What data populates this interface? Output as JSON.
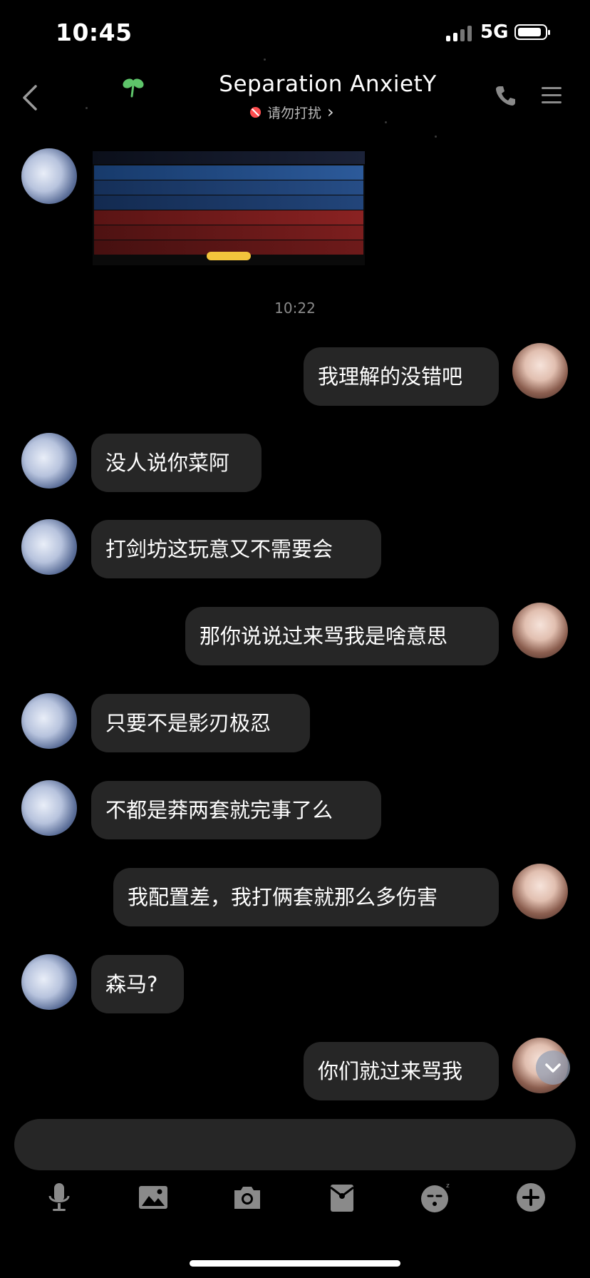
{
  "status_bar": {
    "time": "10:45",
    "network": "5G",
    "battery_level": 0.85
  },
  "header": {
    "title": "Separation AnxietY",
    "subtitle": "请勿打扰",
    "subtitle_chevron": "›"
  },
  "messages": [
    {
      "side": "left",
      "type": "image",
      "description_icon": "game-scoreboard-image"
    },
    {
      "side": "center",
      "type": "timestamp",
      "text": "10:22"
    },
    {
      "side": "right",
      "type": "text",
      "text": "我理解的没错吧"
    },
    {
      "side": "left",
      "type": "text",
      "text": "没人说你菜阿"
    },
    {
      "side": "left",
      "type": "text",
      "text": "打剑坊这玩意又不需要会"
    },
    {
      "side": "right",
      "type": "text",
      "text": "那你说说过来骂我是啥意思"
    },
    {
      "side": "left",
      "type": "text",
      "text": "只要不是影刃极忍"
    },
    {
      "side": "left",
      "type": "text",
      "text": "不都是莽两套就完事了么"
    },
    {
      "side": "right",
      "type": "text",
      "text": "我配置差，我打俩套就那么多伤害"
    },
    {
      "side": "left",
      "type": "text",
      "text": "森马?"
    },
    {
      "side": "right",
      "type": "text",
      "text": "你们就过来骂我"
    }
  ],
  "input": {
    "placeholder": ""
  },
  "toolbar": {
    "icons": [
      "microphone-icon",
      "image-icon",
      "camera-icon",
      "red-packet-icon",
      "sticker-icon",
      "plus-icon"
    ]
  },
  "colors": {
    "background": "#000000",
    "bubble": "#262626",
    "accent_clover": "#5ec46a",
    "dnd_red": "#ff4d4f"
  }
}
